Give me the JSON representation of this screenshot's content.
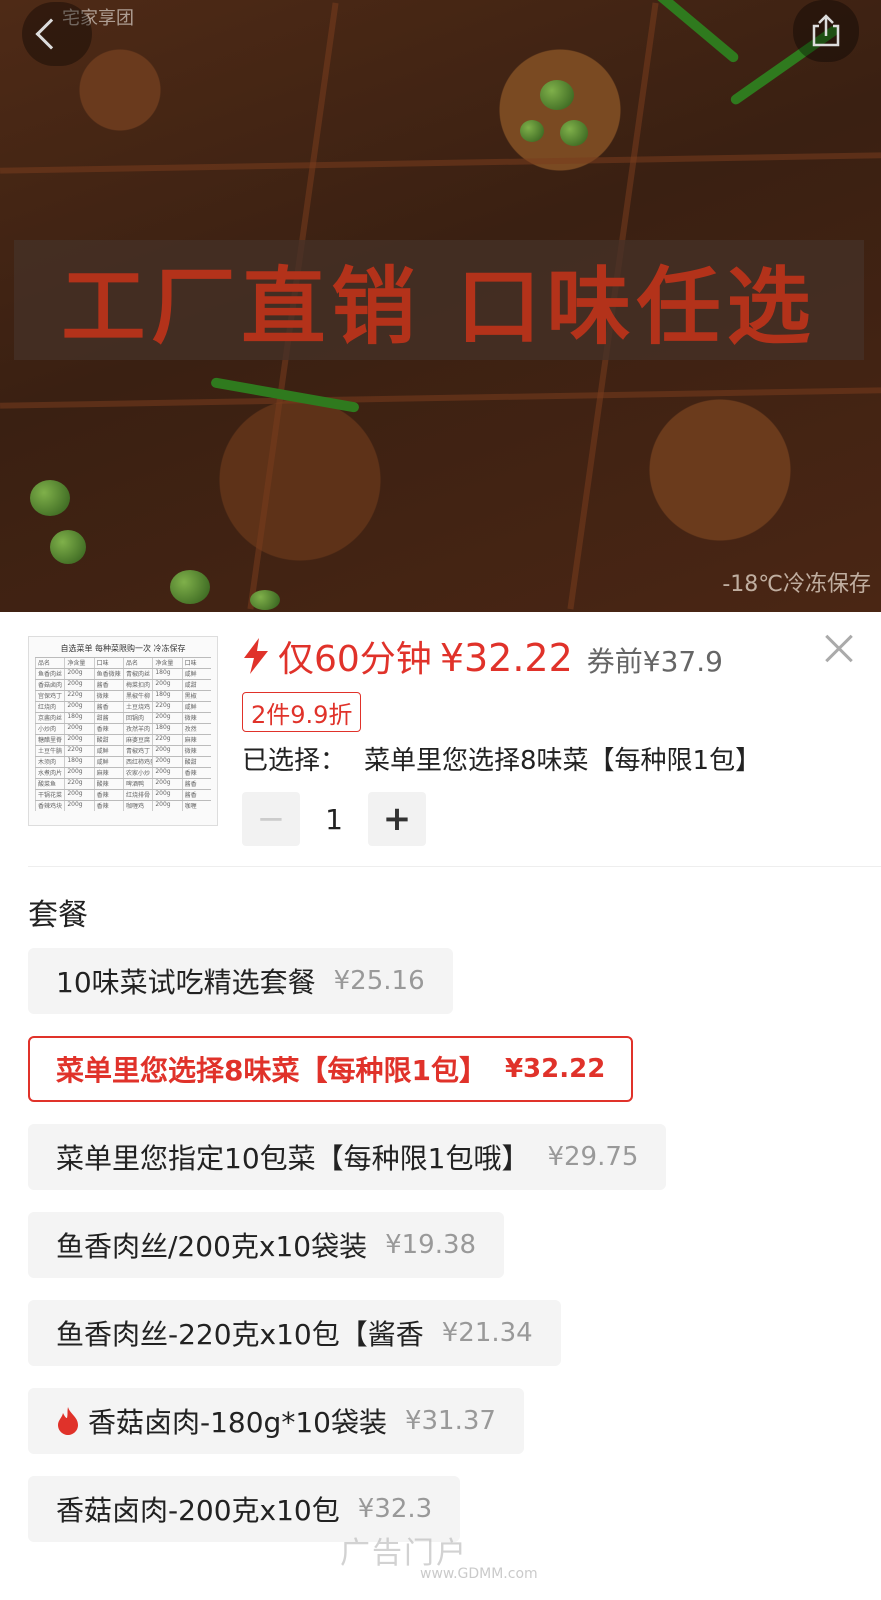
{
  "hero": {
    "banner_text": "工厂直销  口味任选",
    "footnote": "-18℃冷冻保存",
    "tag": "宅家享团"
  },
  "product": {
    "flash_label": "仅60分钟",
    "price_now": "¥32.22",
    "price_before": "券前¥37.9",
    "discount_badge": "2件9.9折",
    "selected_label": "已选择：",
    "selected_value": "菜单里您选择8味菜【每种限1包】",
    "quantity": "1",
    "minus_symbol": "−",
    "plus_symbol": "+"
  },
  "thumb": {
    "title": "自选菜单  每种菜限购一次  冷冻保存",
    "rows": [
      [
        "品名",
        "净含量",
        "口味",
        "品名",
        "净含量",
        "口味"
      ],
      [
        "鱼香肉丝",
        "200g",
        "鱼香微辣",
        "青椒肉丝",
        "180g",
        "咸鲜"
      ],
      [
        "香菇卤肉",
        "200g",
        "酱香",
        "梅菜扣肉",
        "200g",
        "咸甜"
      ],
      [
        "宫保鸡丁",
        "220g",
        "微辣",
        "黑椒牛柳",
        "180g",
        "黑椒"
      ],
      [
        "红烧肉",
        "200g",
        "酱香",
        "土豆烧鸡",
        "220g",
        "咸鲜"
      ],
      [
        "京酱肉丝",
        "180g",
        "甜酱",
        "回锅肉",
        "200g",
        "微辣"
      ],
      [
        "小炒肉",
        "200g",
        "香辣",
        "孜然羊肉",
        "180g",
        "孜然"
      ],
      [
        "糖醋里脊",
        "200g",
        "酸甜",
        "麻婆豆腐",
        "220g",
        "麻辣"
      ],
      [
        "土豆牛腩",
        "220g",
        "咸鲜",
        "青椒鸡丁",
        "200g",
        "微辣"
      ],
      [
        "木须肉",
        "180g",
        "咸鲜",
        "西红柿鸡蛋",
        "200g",
        "酸甜"
      ],
      [
        "水煮肉片",
        "200g",
        "麻辣",
        "农家小炒",
        "200g",
        "香辣"
      ],
      [
        "酸菜鱼",
        "220g",
        "酸辣",
        "啤酒鸭",
        "200g",
        "酱香"
      ],
      [
        "干锅花菜",
        "200g",
        "香辣",
        "红烧排骨",
        "200g",
        "酱香"
      ],
      [
        "香辣鸡块",
        "200g",
        "香辣",
        "咖喱鸡",
        "200g",
        "咖喱"
      ]
    ]
  },
  "section_title": "套餐",
  "options": [
    {
      "label": "10味菜试吃精选套餐",
      "price": "¥25.16",
      "selected": false,
      "hot": false
    },
    {
      "label": "菜单里您选择8味菜【每种限1包】",
      "price": "¥32.22",
      "selected": true,
      "hot": false
    },
    {
      "label": "菜单里您指定10包菜【每种限1包哦】",
      "price": "¥29.75",
      "selected": false,
      "hot": false
    },
    {
      "label": "鱼香肉丝/200克x10袋装",
      "price": "¥19.38",
      "selected": false,
      "hot": false
    },
    {
      "label": "鱼香肉丝-220克x10包【酱香",
      "price": "¥21.34",
      "selected": false,
      "hot": false
    },
    {
      "label": "香菇卤肉-180g*10袋装",
      "price": "¥31.37",
      "selected": false,
      "hot": true
    },
    {
      "label": "香菇卤肉-200克x10包",
      "price": "¥32.3",
      "selected": false,
      "hot": false
    }
  ],
  "watermark": {
    "text": "广告门户",
    "url": "www.GDMM.com"
  },
  "colors": {
    "accent": "#e0322a",
    "chip_bg": "#f4f4f4"
  },
  "icons": [
    "back-chevron-icon",
    "share-icon",
    "flash-icon",
    "close-icon",
    "fire-icon"
  ]
}
